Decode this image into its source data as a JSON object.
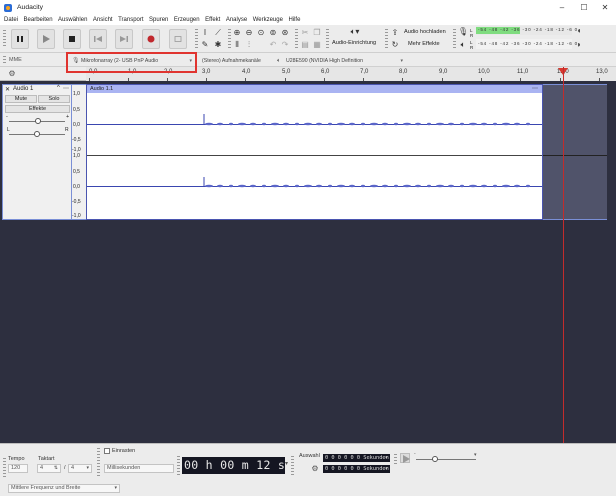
{
  "window": {
    "title": "Audacity",
    "minimize": "–",
    "maximize": "☐",
    "close": "✕"
  },
  "menu": [
    "Datei",
    "Bearbeiten",
    "Auswählen",
    "Ansicht",
    "Transport",
    "Spuren",
    "Erzeugen",
    "Effekt",
    "Analyse",
    "Werkzeuge",
    "Hilfe"
  ],
  "toolbar": {
    "audio_setup_label": "Audio-Einrichtung",
    "share_audio_label": "Audio hochladen",
    "more_effects_label": "Mehr Effekte",
    "meter_ticks_top": "-54 -48 -42 -36 -30 -24 -18 -12 -6 0",
    "meter_ticks_bottom": "-54 -48 -42 -36 -30 -24 -18 -12 -6 0",
    "meter_L": "L",
    "meter_R": "R"
  },
  "devices": {
    "host": "MME",
    "recording_device": "Mikrofonarray (2- USB PnP Audio",
    "channels": "(Stereo) Aufnahmekanäle",
    "playback_device": "U28E590 (NVIDIA High Definition"
  },
  "ruler": {
    "ticks": [
      "0,0",
      "1,0",
      "2,0",
      "3,0",
      "4,0",
      "5,0",
      "6,0",
      "7,0",
      "8,0",
      "9,0",
      "10,0",
      "11,0",
      "12,0",
      "13,0"
    ]
  },
  "track": {
    "name": "Audio 1",
    "mute_label": "Mute",
    "solo_label": "Solo",
    "effects_label": "Effekte",
    "gain_minus": "-",
    "gain_plus": "+",
    "pan_left": "L",
    "pan_right": "R",
    "clip_name": "Audio 1.1",
    "scale_top": [
      "1,0",
      "0,5",
      "0,0",
      "-0,5",
      "-1,0"
    ],
    "scale_bottom": [
      "1,0",
      "0,5",
      "0,0",
      "-0,5",
      "-1,0"
    ]
  },
  "bottom": {
    "tempo_label": "Tempo",
    "tempo_value": "120",
    "timesig_label": "Taktart",
    "timesig_num": "4",
    "timesig_slash": "/",
    "timesig_den": "4",
    "snap_label": "Einrasten",
    "snap_unit": "Millisekunden",
    "time_display": "00 h 00 m 12 s",
    "selection_label": "Auswahl",
    "sel_start": "0 0 0 0 0 0 Sekunden",
    "sel_end": "0 0 0 0 0 0 Sekunden",
    "freq_option": "Mittlere Frequenz und Breite"
  }
}
